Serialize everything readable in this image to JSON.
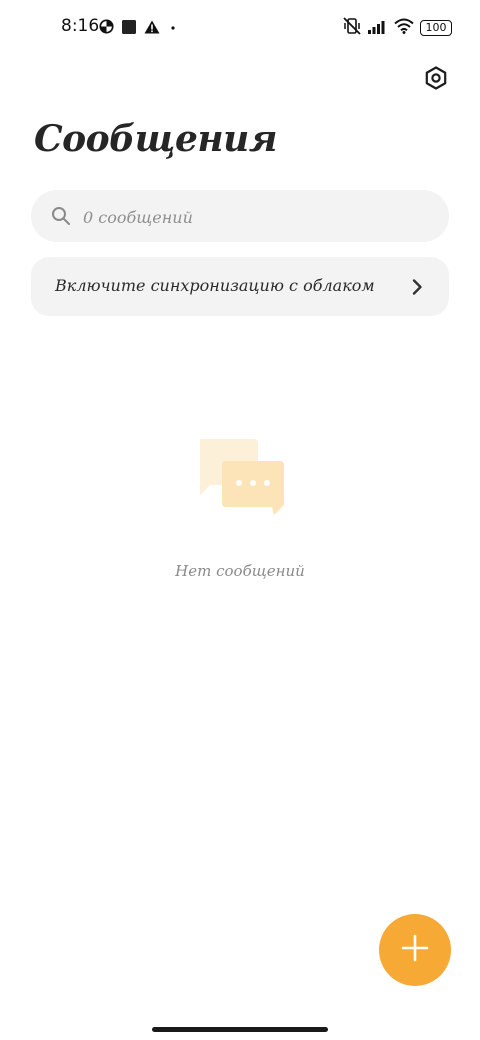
{
  "status_bar": {
    "time": "8:16",
    "battery": "100",
    "icons": [
      "data-saver-icon",
      "square-icon",
      "warning-icon",
      "dot-icon",
      "vibrate-off-icon",
      "signal-icon",
      "wifi-icon",
      "battery-icon"
    ]
  },
  "header": {
    "title": "Сообщения",
    "settings_icon": "settings-hexagon-icon"
  },
  "search": {
    "placeholder": "0 сообщений",
    "value": ""
  },
  "sync_banner": {
    "label": "Включите синхронизацию с облаком",
    "chevron_icon": "chevron-right-icon"
  },
  "empty_state": {
    "icon": "chat-bubbles-icon",
    "text": "Нет сообщений"
  },
  "fab": {
    "icon": "plus-icon"
  },
  "colors": {
    "accent": "#f6a935",
    "surface": "#f3f3f3",
    "illustration_light": "#fdf0d8",
    "illustration_mid": "#fce3b8"
  }
}
